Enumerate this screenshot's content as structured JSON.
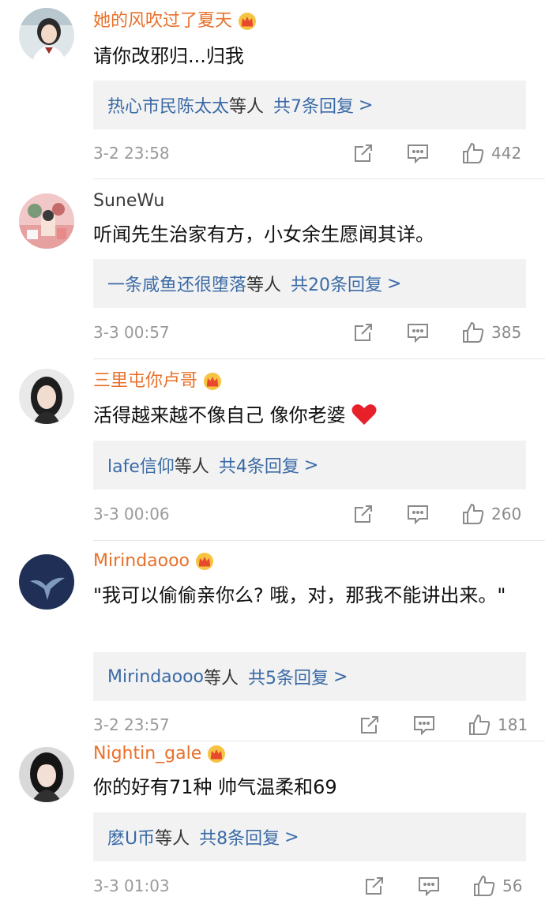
{
  "comments": [
    {
      "username": "她的风吹过了夏天",
      "vip": true,
      "text": "请你改邪归...归我",
      "reply_user": "热心市民陈太太",
      "reply_others": "等人",
      "reply_count": "共7条回复",
      "reply_arrow": ">",
      "time": "3-2 23:58",
      "likes": "442",
      "avatar_icon": "girl-uniform-avatar",
      "avatar_colors": [
        "#dfe6ea",
        "#2b2b2b",
        "#f3d9c8"
      ]
    },
    {
      "username": "SuneWu",
      "vip": false,
      "text": "听闻先生治家有方，小女余生愿闻其详。",
      "reply_user": "一条咸鱼还很堕落",
      "reply_others": "等人",
      "reply_count": "共20条回复",
      "reply_arrow": ">",
      "time": "3-3 00:57",
      "likes": "385",
      "avatar_icon": "illustration-avatar",
      "avatar_colors": [
        "#f2c7c7",
        "#7a9a7a",
        "#e88a8a"
      ]
    },
    {
      "username": "三里屯你卢哥",
      "vip": true,
      "text": "活得越来越不像自己 像你老婆",
      "has_heart": true,
      "reply_user": "lafe信仰",
      "reply_others": "等人",
      "reply_count": "共4条回复",
      "reply_arrow": ">",
      "time": "3-3 00:06",
      "likes": "260",
      "avatar_icon": "girl-portrait-avatar",
      "avatar_colors": [
        "#e9e9e9",
        "#1e1e1e",
        "#f1dccf"
      ]
    },
    {
      "username": "Mirindaooo",
      "vip": true,
      "text": "\"我可以偷偷亲你么? 哦，对，那我不能讲出来。\"",
      "reply_user": "Mirindaooo",
      "reply_others": "等人",
      "reply_count": "共5条回复",
      "reply_arrow": ">",
      "time": "3-2 23:57",
      "likes": "181",
      "avatar_icon": "whale-tail-avatar",
      "avatar_colors": [
        "#1f2f55",
        "#8aa6c9"
      ]
    },
    {
      "username": "Nightin_gale",
      "vip": true,
      "text": "你的好有71种 帅气温柔和69",
      "reply_user": "麽U币",
      "reply_others": "等人",
      "reply_count": "共8条回复",
      "reply_arrow": ">",
      "time": "3-3 01:03",
      "likes": "56",
      "avatar_icon": "girl-selfie-avatar",
      "avatar_colors": [
        "#d9d9d9",
        "#151515",
        "#f3dfd3"
      ]
    }
  ],
  "colors": {
    "vip_name": "#e8702a",
    "link": "#3a6aa6",
    "reply_bg": "#f2f2f2",
    "meta": "#9a9a9a"
  }
}
